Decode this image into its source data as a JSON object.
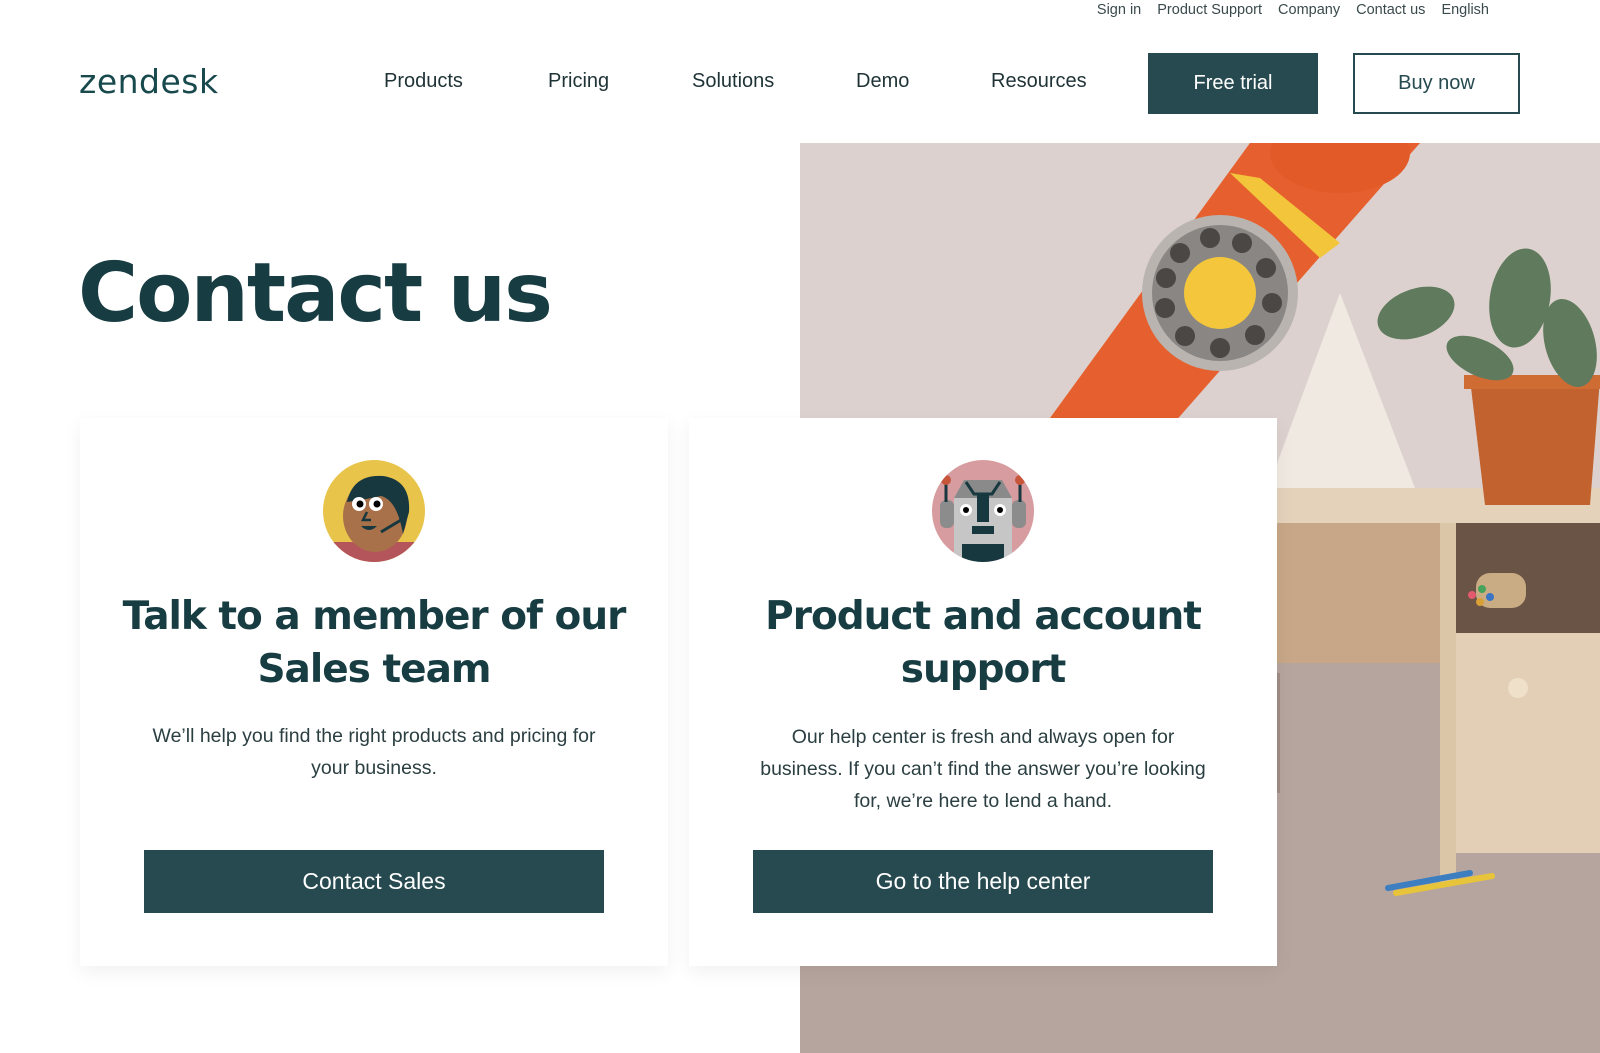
{
  "utility_nav": {
    "items": [
      "Sign in",
      "Product Support",
      "Company",
      "Contact us",
      "English"
    ]
  },
  "header": {
    "logo": "zendesk",
    "nav": [
      "Products",
      "Pricing",
      "Solutions",
      "Demo",
      "Resources"
    ],
    "free_trial_label": "Free trial",
    "buy_now_label": "Buy now"
  },
  "hero": {
    "title": "Contact us",
    "image_description": "Orange rotary phone handset leaning on white triangle, potted plant and wooden desk with pencils"
  },
  "cards": [
    {
      "avatar_icon": "agent-avatar-icon",
      "heading": "Talk to a member of our Sales team",
      "body": "We’ll help you find the right products and pricing for your business.",
      "button_label": "Contact Sales"
    },
    {
      "avatar_icon": "robot-avatar-icon",
      "heading": "Product and account support",
      "body": "Our help center is fresh and always open for business. If you can’t find the answer you’re looking for, we’re here to lend a hand.",
      "button_label": "Go to the help center"
    }
  ],
  "colors": {
    "brand_dark": "#264a4f",
    "heading": "#173c42",
    "background": "#ffffff"
  }
}
